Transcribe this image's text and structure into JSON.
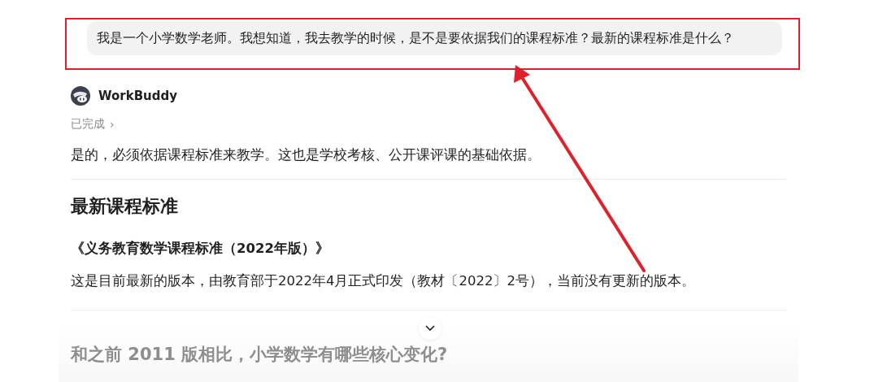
{
  "user_message": {
    "text": "我是一个小学数学老师。我想知道，我去教学的时候，是不是要依据我们的课程标准？最新的课程标准是什么？"
  },
  "assistant": {
    "name": "WorkBuddy",
    "status": "已完成",
    "status_chevron": "›"
  },
  "answer": [
    {
      "kind": "paragraph",
      "text": "是的，必须依据课程标准来教学。这也是学校考核、公开课评课的基础依据。"
    },
    {
      "kind": "divider"
    },
    {
      "kind": "heading",
      "text": "最新课程标准"
    },
    {
      "kind": "subheading",
      "text": "《义务教育数学课程标准（2022年版）》"
    },
    {
      "kind": "paragraph",
      "text": "这是目前最新的版本，由教育部于2022年4月正式印发（教材〔2022〕2号），当前没有更新的版本。"
    },
    {
      "kind": "divider"
    },
    {
      "kind": "faded_heading",
      "text": "和之前 2011 版相比，小学数学有哪些核心变化?"
    }
  ]
}
